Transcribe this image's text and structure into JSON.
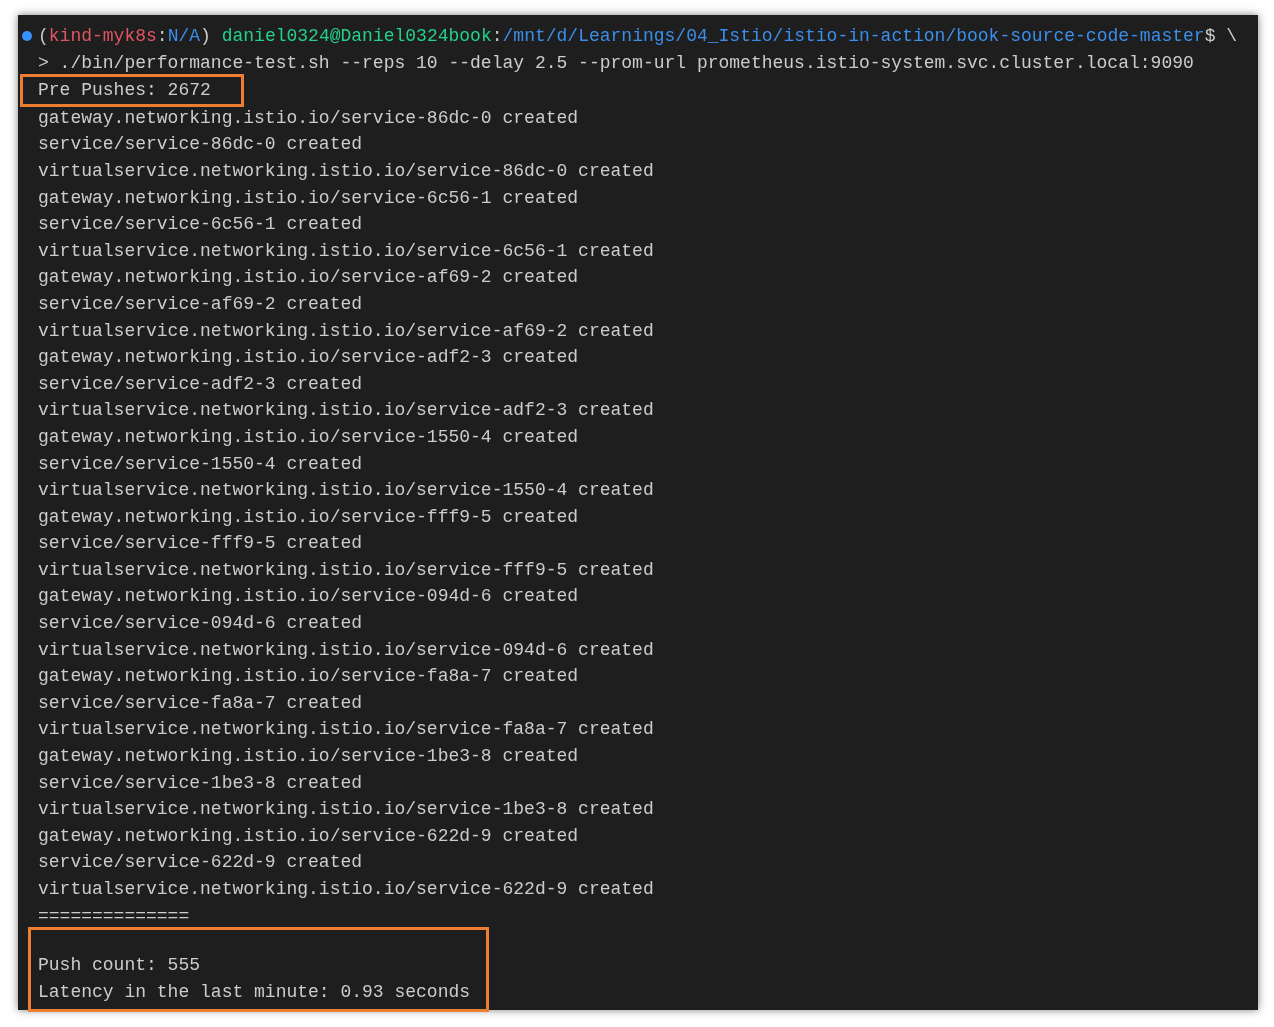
{
  "prompt": {
    "segments": [
      {
        "text": "(",
        "color": "#cccccc"
      },
      {
        "text": "kind-myk8s",
        "color": "#e05561"
      },
      {
        "text": ":",
        "color": "#cccccc"
      },
      {
        "text": "N/A",
        "color": "#3b8eea"
      },
      {
        "text": ")",
        "color": "#cccccc"
      },
      {
        "text": "daniel0324@Daniel0324book",
        "color": "#23d18b"
      },
      {
        "text": ":",
        "color": "#cccccc"
      },
      {
        "text": "/mnt/d/Learnings/04_Istio/istio-in-action/book-source-code-master",
        "color": "#3b8eea"
      },
      {
        "text": "$ \\",
        "color": "#cccccc"
      }
    ],
    "command": "> ./bin/performance-test.sh --reps 10 --delay 2.5 --prom-url prometheus.istio-system.svc.cluster.local:9090"
  },
  "blocks": [
    {
      "highlighted": true,
      "blank_before": false,
      "lines": [
        "Pre Pushes: 2672"
      ]
    },
    {
      "highlighted": false,
      "blank_before": false,
      "lines": [
        "gateway.networking.istio.io/service-86dc-0 created",
        "service/service-86dc-0 created",
        "virtualservice.networking.istio.io/service-86dc-0 created",
        "gateway.networking.istio.io/service-6c56-1 created",
        "service/service-6c56-1 created",
        "virtualservice.networking.istio.io/service-6c56-1 created",
        "gateway.networking.istio.io/service-af69-2 created",
        "service/service-af69-2 created",
        "virtualservice.networking.istio.io/service-af69-2 created",
        "gateway.networking.istio.io/service-adf2-3 created",
        "service/service-adf2-3 created",
        "virtualservice.networking.istio.io/service-adf2-3 created",
        "gateway.networking.istio.io/service-1550-4 created",
        "service/service-1550-4 created",
        "virtualservice.networking.istio.io/service-1550-4 created",
        "gateway.networking.istio.io/service-fff9-5 created",
        "service/service-fff9-5 created",
        "virtualservice.networking.istio.io/service-fff9-5 created",
        "gateway.networking.istio.io/service-094d-6 created",
        "service/service-094d-6 created",
        "virtualservice.networking.istio.io/service-094d-6 created",
        "gateway.networking.istio.io/service-fa8a-7 created",
        "service/service-fa8a-7 created",
        "virtualservice.networking.istio.io/service-fa8a-7 created",
        "gateway.networking.istio.io/service-1be3-8 created",
        "service/service-1be3-8 created",
        "virtualservice.networking.istio.io/service-1be3-8 created",
        "gateway.networking.istio.io/service-622d-9 created",
        "service/service-622d-9 created",
        "virtualservice.networking.istio.io/service-622d-9 created",
        "=============="
      ]
    },
    {
      "highlighted": true,
      "blank_before": true,
      "lines": [
        "Push count: 555",
        "Latency in the last minute: 0.93 seconds"
      ]
    }
  ]
}
